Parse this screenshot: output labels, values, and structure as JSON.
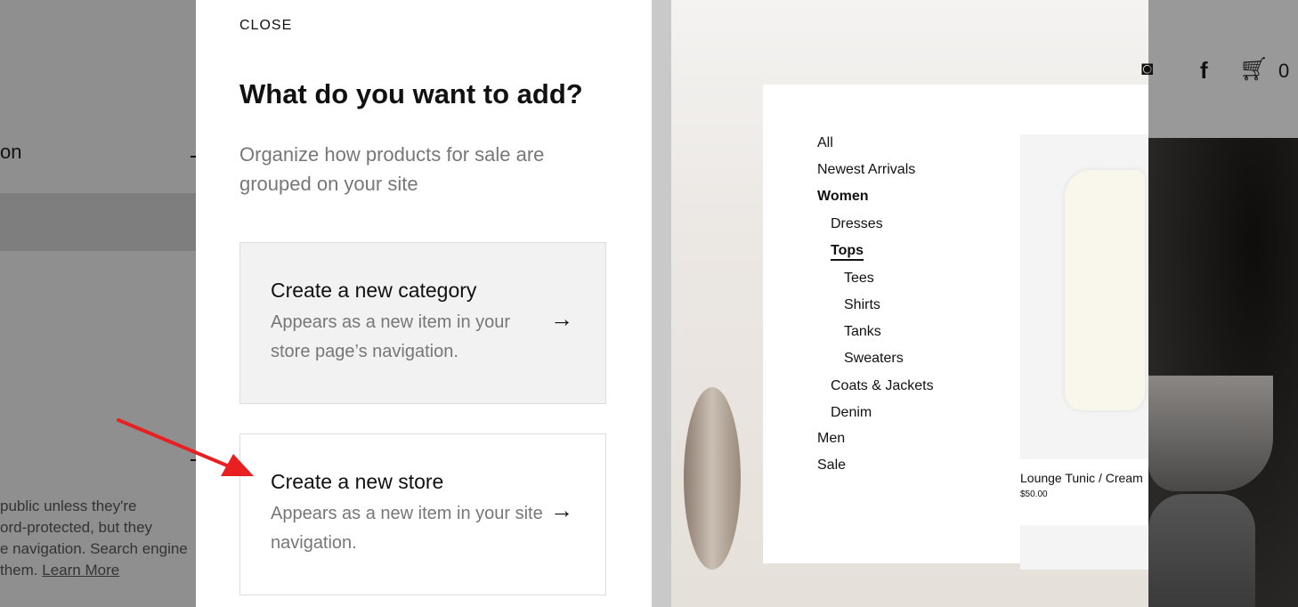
{
  "background": {
    "section_title_fragment": "on",
    "description_lines": [
      "public unless they're",
      "ord-protected, but they",
      "e navigation. Search engine",
      "them."
    ],
    "learn_more": "Learn More"
  },
  "dialog": {
    "close_label": "CLOSE",
    "title": "What do you want to add?",
    "subtitle": "Organize how products for sale are grouped on your site",
    "options": [
      {
        "title": "Create a new category",
        "description": "Appears as a new item in your store page’s navigation."
      },
      {
        "title": "Create a new store",
        "description": "Appears as a new item in your site navigation."
      }
    ]
  },
  "preview": {
    "nav": [
      "All",
      "Newest Arrivals",
      "Women",
      "Dresses",
      "Tops",
      "Tees",
      "Shirts",
      "Tanks",
      "Sweaters",
      "Coats & Jackets",
      "Denim",
      "Men",
      "Sale"
    ],
    "product": {
      "name": "Lounge Tunic / Cream",
      "price": "$50.00"
    },
    "cart_count": "0",
    "icons": [
      "instagram-icon",
      "facebook-icon",
      "cart-icon"
    ]
  },
  "annotation": {
    "arrow_color": "#e8201f"
  }
}
